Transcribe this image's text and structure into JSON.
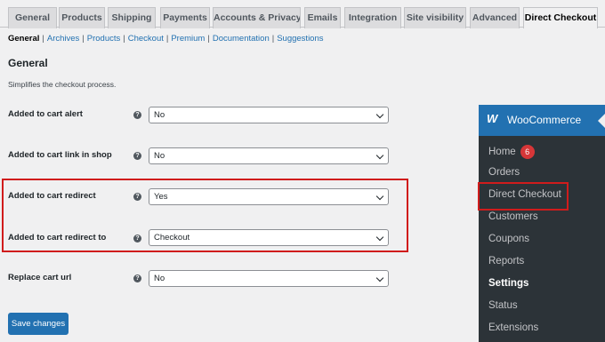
{
  "tabs": [
    "General",
    "Products",
    "Shipping",
    "Payments",
    "Accounts & Privacy",
    "Emails",
    "Integration",
    "Site visibility",
    "Advanced",
    "Direct Checkout"
  ],
  "subnav": {
    "current": "General",
    "links": [
      "Archives",
      "Products",
      "Checkout",
      "Premium",
      "Documentation",
      "Suggestions"
    ],
    "separator": "|"
  },
  "section": {
    "title": "General",
    "description": "Simplifies the checkout process."
  },
  "help_glyph": "?",
  "settings": [
    {
      "label": "Added to cart alert",
      "value": "No"
    },
    {
      "label": "Added to cart link in shop",
      "value": "No"
    },
    {
      "label": "Added to cart redirect",
      "value": "Yes"
    },
    {
      "label": "Added to cart redirect to",
      "value": "Checkout"
    },
    {
      "label": "Replace cart url",
      "value": "No"
    }
  ],
  "save_button": "Save changes",
  "wp_menu": {
    "logo": "W",
    "title": "WooCommerce",
    "items": [
      "Home",
      "Orders",
      "Direct Checkout",
      "Customers",
      "Coupons",
      "Reports",
      "Settings",
      "Status",
      "Extensions"
    ],
    "home_badge": "6"
  },
  "colors": {
    "accent": "#2271b1",
    "highlight": "#d01c1c",
    "badge": "#d63638",
    "menu_bg": "#1d2327"
  }
}
